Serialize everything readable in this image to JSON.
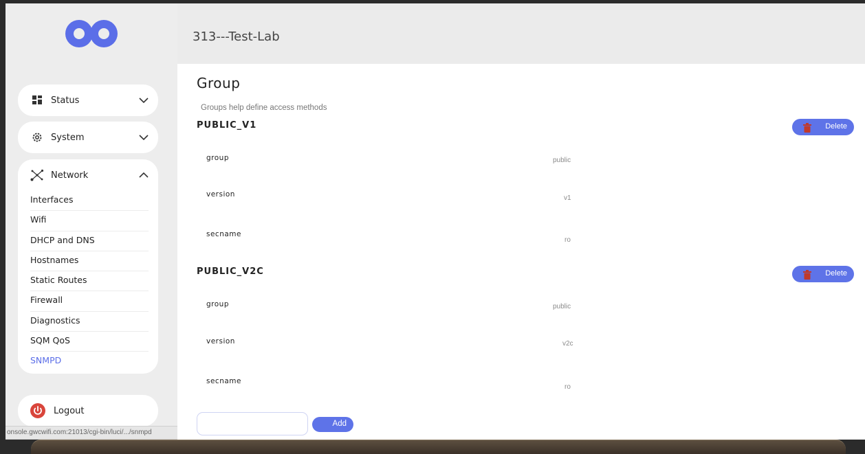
{
  "app": {
    "title": "313---Test-Lab",
    "accent_color": "#5b6ee8",
    "logo_icon": "infinity-logo-icon"
  },
  "sidebar": {
    "groups": [
      {
        "label": "Status",
        "icon": "dashboard-icon",
        "expanded": false
      },
      {
        "label": "System",
        "icon": "gear-icon",
        "expanded": false
      },
      {
        "label": "Network",
        "icon": "network-icon",
        "expanded": true
      }
    ],
    "network_items": [
      {
        "label": "Interfaces"
      },
      {
        "label": "Wifi"
      },
      {
        "label": "DHCP and DNS"
      },
      {
        "label": "Hostnames"
      },
      {
        "label": "Static Routes"
      },
      {
        "label": "Firewall"
      },
      {
        "label": "Diagnostics"
      },
      {
        "label": "SQM QoS"
      },
      {
        "label": "SNMPD",
        "active": true
      }
    ],
    "logout_label": "Logout"
  },
  "page": {
    "title": "Group",
    "description": "Groups help define access methods"
  },
  "sections": [
    {
      "name": "PUBLIC_V1",
      "delete_label": "Delete",
      "rows": [
        {
          "label": "group",
          "value": "public"
        },
        {
          "label": "version",
          "value": "v1"
        },
        {
          "label": "secname",
          "value": "ro"
        }
      ]
    },
    {
      "name": "PUBLIC_V2C",
      "delete_label": "Delete",
      "rows": [
        {
          "label": "group",
          "value": "public"
        },
        {
          "label": "version",
          "value": "v2c"
        },
        {
          "label": "secname",
          "value": "ro"
        }
      ]
    }
  ],
  "add": {
    "input_value": "",
    "button_label": "Add"
  },
  "status_url": "onsole.gwcwifi.com:21013/cgi-bin/luci/.../snmpd"
}
